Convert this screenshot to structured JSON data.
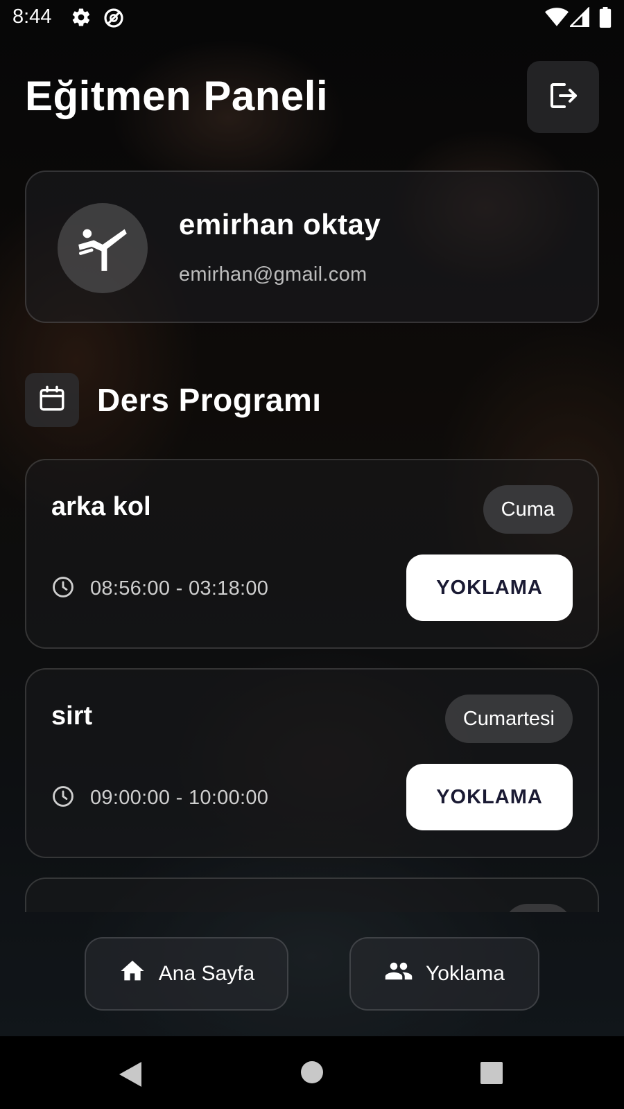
{
  "status_bar": {
    "time": "8:44",
    "icons": [
      "gear-icon",
      "data-saver-icon",
      "wifi-icon",
      "cell-signal-icon",
      "battery-icon"
    ]
  },
  "header": {
    "title": "Eğitmen Paneli",
    "logout_icon": "logout-icon"
  },
  "profile": {
    "name": "emirhan oktay",
    "email": "emirhan@gmail.com",
    "avatar_icon": "martial-arts-kick-icon"
  },
  "schedule": {
    "title": "Ders Programı",
    "icon": "calendar-icon",
    "lessons": [
      {
        "name": "arka kol",
        "day": "Cuma",
        "time": "08:56:00 - 03:18:00",
        "button": "YOKLAMA"
      },
      {
        "name": "sirt",
        "day": "Cumartesi",
        "time": "09:00:00 - 10:00:00",
        "button": "YOKLAMA"
      }
    ]
  },
  "bottom_nav": {
    "home": {
      "label": "Ana Sayfa",
      "icon": "home-icon"
    },
    "attendance": {
      "label": "Yoklama",
      "icon": "group-icon"
    }
  },
  "system_nav": [
    "back-icon",
    "home-circle-icon",
    "recents-icon"
  ],
  "colors": {
    "accent_button_bg": "#ffffff",
    "accent_button_text": "#1a1a33"
  }
}
